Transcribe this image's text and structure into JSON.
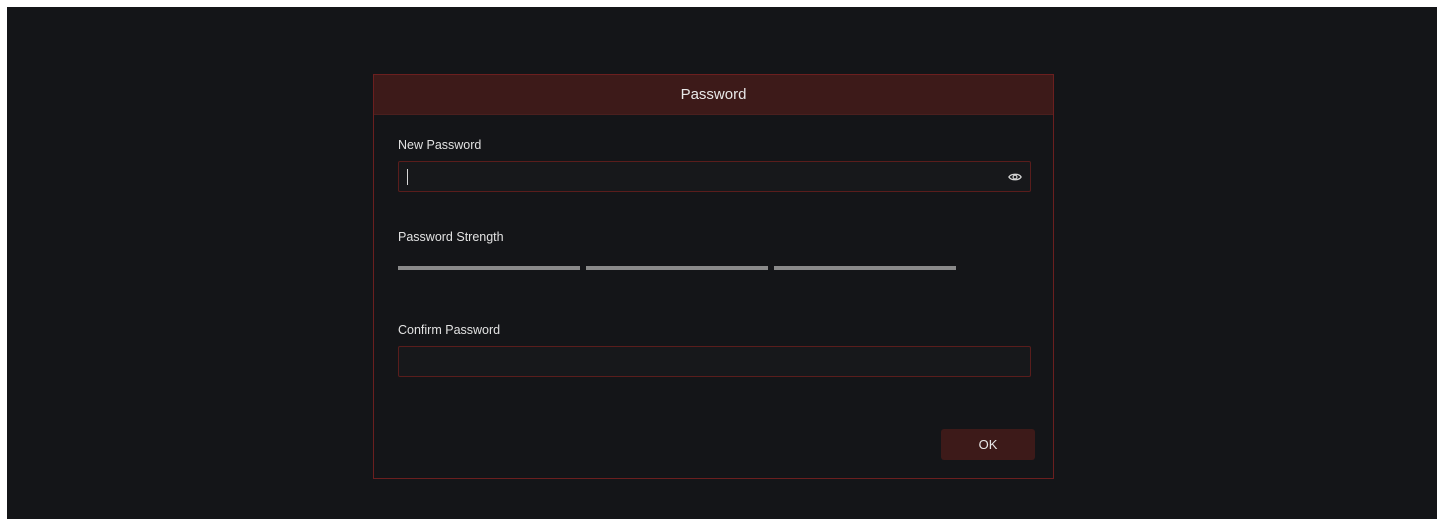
{
  "dialog": {
    "title": "Password",
    "new_password": {
      "label": "New Password",
      "value": "",
      "reveal_icon": "eye-icon"
    },
    "strength": {
      "label": "Password Strength",
      "segments": 3,
      "level": 0,
      "inactive_color": "#8a8a8a"
    },
    "confirm_password": {
      "label": "Confirm Password",
      "value": ""
    },
    "ok_label": "OK"
  },
  "colors": {
    "background": "#141518",
    "accent_dark": "#3d1a19",
    "border": "#6b1f1f",
    "text": "#e8e8e8"
  }
}
